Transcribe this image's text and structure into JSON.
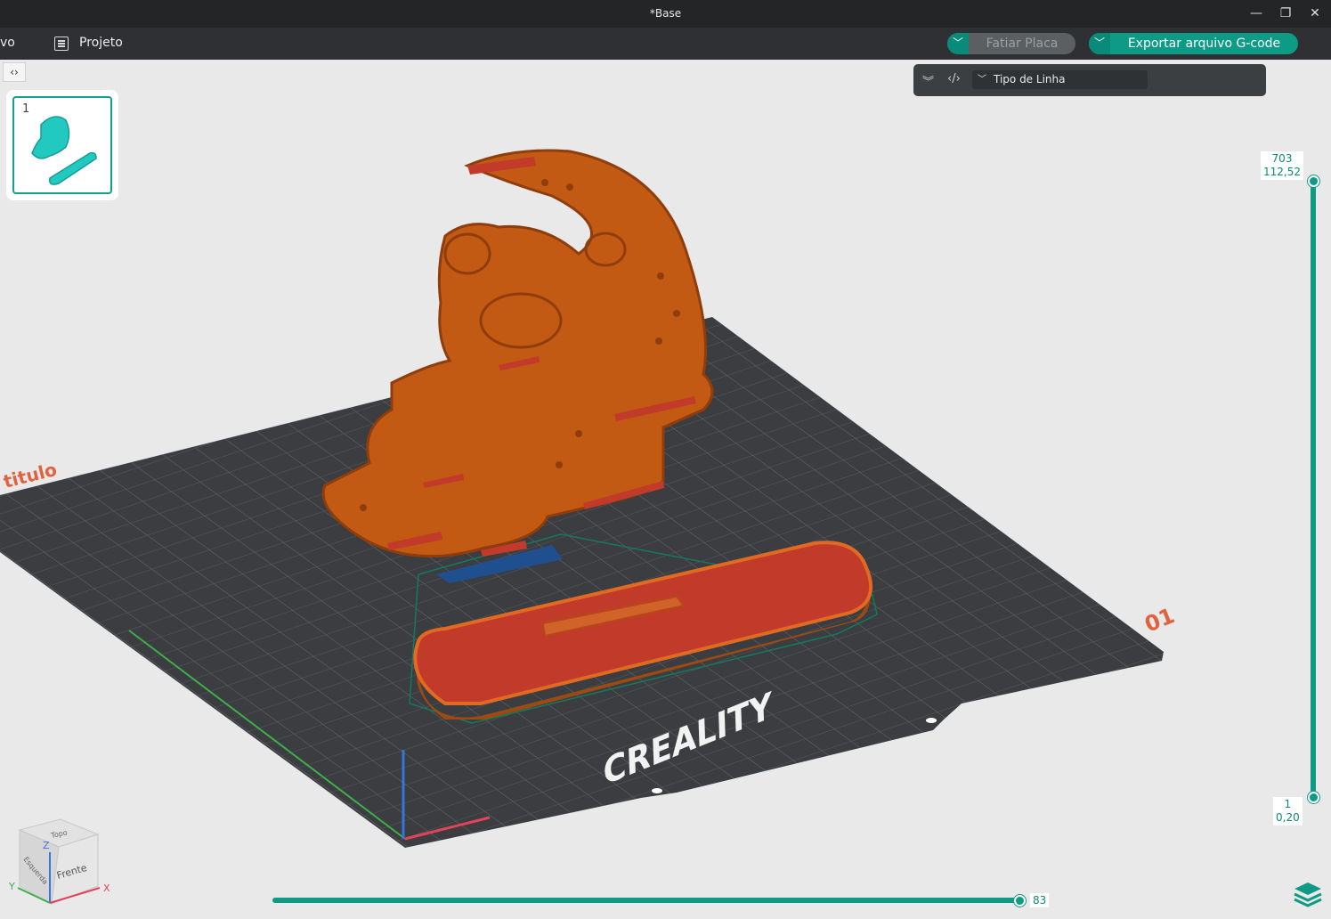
{
  "window": {
    "title": "*Base",
    "minimize_glyph": "—",
    "restore_glyph": "❐",
    "close_glyph": "✕"
  },
  "menubar": {
    "file_label": "vo",
    "project_label": "Projeto",
    "project_icon": "document-list-icon"
  },
  "actions": {
    "slice_label": "Fatiar Placa",
    "export_label": "Exportar arquivo G-code",
    "dropdown_glyph": "﹀"
  },
  "viewport": {
    "collapse_glyph": "‹›",
    "plate": {
      "number": "1",
      "plate_name_left": "titulo",
      "plate_number_right": "01",
      "brand_text": "CREALITY"
    },
    "line_type_panel": {
      "collapse_icon": "double-chevron-down-icon",
      "code_icon": "code-icon",
      "selected_option": "Tipo de Linha",
      "dropdown_glyph": "﹀"
    },
    "layer_slider": {
      "top_layer": "703",
      "top_height": "112,52",
      "bottom_layer": "1",
      "bottom_height": "0,20",
      "top_fraction": 1.0,
      "bottom_fraction": 0.0
    },
    "move_slider": {
      "value": "83",
      "fraction": 1.0
    },
    "view_cube": {
      "top_face": "Topo",
      "front_face": "Frente",
      "left_face": "Esquerda",
      "axis_x": "X",
      "axis_y": "Y",
      "axis_z": "Z"
    },
    "colors": {
      "accent": "#0e9a85",
      "plate": "#3b3d40",
      "model_orange": "#c25a14",
      "model_red": "#c23a2a",
      "support_blue": "#1f4f8f"
    }
  }
}
